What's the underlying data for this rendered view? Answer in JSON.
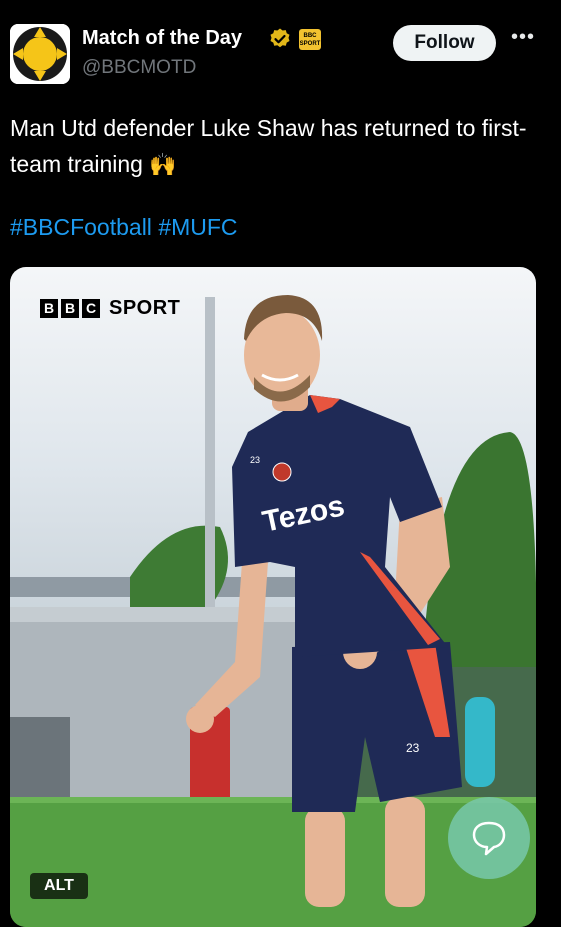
{
  "account": {
    "display_name": "Match of the Day",
    "handle": "@BBCMOTD",
    "affiliation_badge_text": "BBC SPORT",
    "follow_label": "Follow",
    "more_label": "•••"
  },
  "tweet": {
    "text": "Man Utd defender Luke Shaw has returned to first-team training",
    "emoji": "🙌",
    "hashtags": [
      "#BBCFootball",
      "#MUFC"
    ]
  },
  "media": {
    "logo_letters": [
      "B",
      "B",
      "C"
    ],
    "logo_word": "SPORT",
    "shirt_sponsor": "Tezos",
    "shirt_number": "23",
    "alt_label": "ALT"
  },
  "colors": {
    "background": "#000000",
    "link": "#1d9bf0",
    "verified": "#e2b719",
    "kit_navy": "#1f2a56",
    "kit_red": "#e8553f"
  },
  "icons": [
    "verified-badge-icon",
    "affiliate-badge-icon",
    "more-icon",
    "reply-bubble-icon"
  ]
}
